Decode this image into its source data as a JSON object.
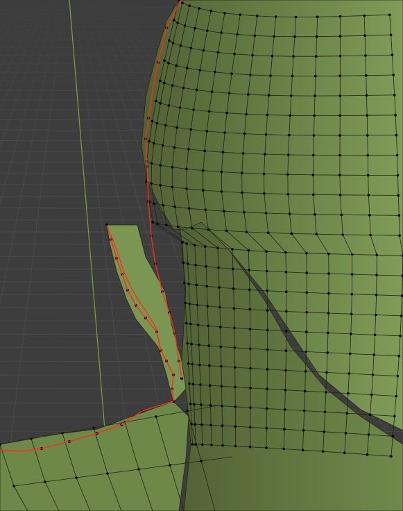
{
  "viewport": {
    "mode": "edit-mode",
    "colors": {
      "background": "#3d3d3d",
      "grid_line": "#4a4a4a",
      "grid_fade": "#474747",
      "y_axis": "#7fa336",
      "mesh_fill_dark": "#4d5a31",
      "mesh_fill_mid": "#6b8448",
      "mesh_fill_light": "#8aa761",
      "wire": "#1f250f",
      "vertex": "#000000",
      "selection_edge": "#ff2a1a"
    }
  }
}
